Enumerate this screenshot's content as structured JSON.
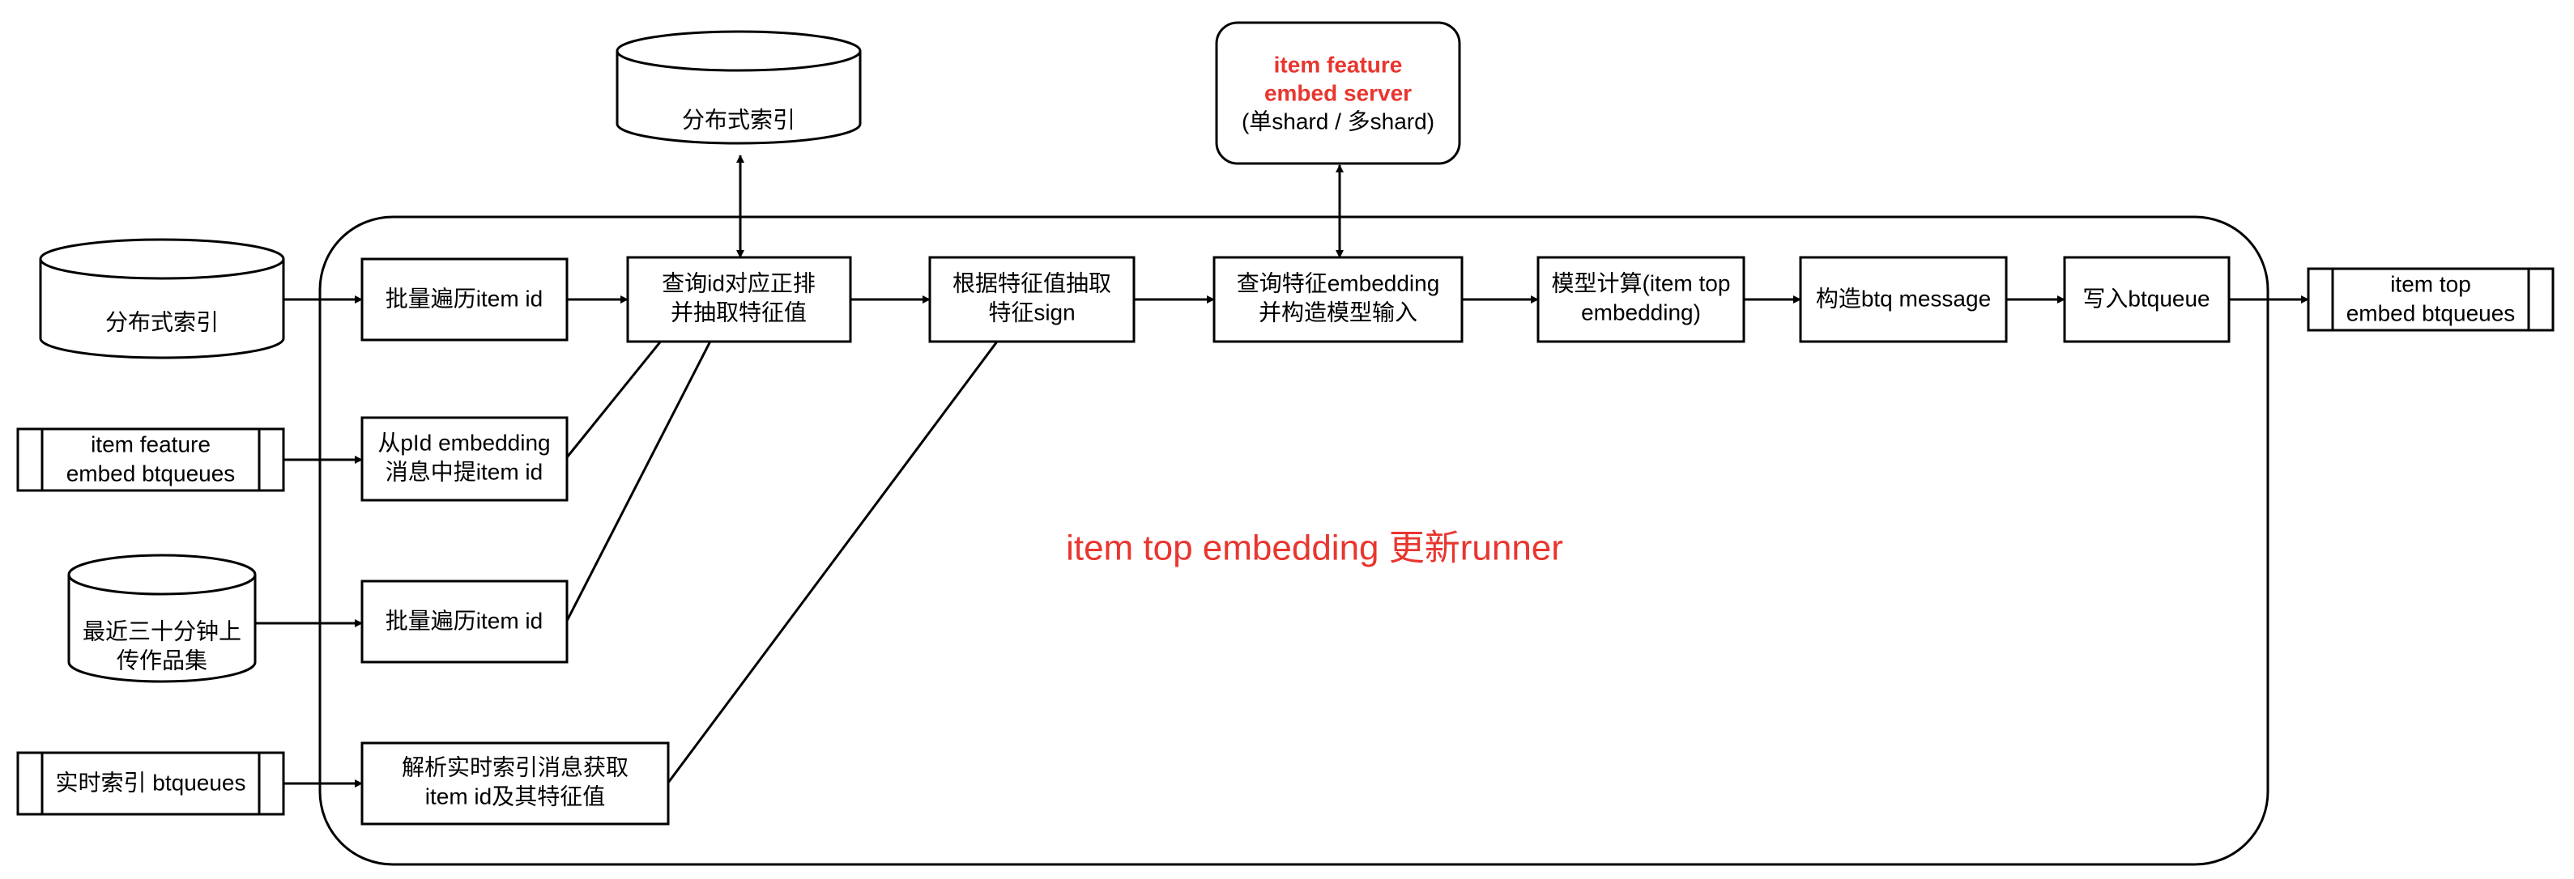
{
  "colors": {
    "accent_red": "#E8362F",
    "stroke": "#000000",
    "background": "#FFFFFF"
  },
  "container_label": "item top embedding 更新runner",
  "sources": {
    "dist_index_left": "分布式索引",
    "item_feature_queue": [
      "item feature",
      "embed btqueues"
    ],
    "recent_items": [
      "最近三十分钟上",
      "传作品集"
    ],
    "realtime_index_queue": "实时索引 btqueues"
  },
  "top": {
    "dist_index_top": "分布式索引",
    "embed_server": [
      "item feature",
      "embed server",
      "(单shard / 多shard)"
    ]
  },
  "steps": {
    "batch_traverse_1": "批量遍历item id",
    "extract_from_pid": [
      "从pId embedding",
      "消息中提item id"
    ],
    "batch_traverse_2": "批量遍历item id",
    "parse_realtime": [
      "解析实时索引消息获取",
      "item id及其特征值"
    ],
    "query_forward": [
      "查询id对应正排",
      "并抽取特征值"
    ],
    "extract_sign": [
      "根据特征值抽取",
      "特征sign"
    ],
    "query_embedding": [
      "查询特征embedding",
      "并构造模型输入"
    ],
    "model_compute": [
      "模型计算(item top",
      "embedding)"
    ],
    "build_message": "构造btq message",
    "write_queue": "写入btqueue"
  },
  "sink": {
    "output_queue": [
      "item top",
      "embed btqueues"
    ]
  }
}
